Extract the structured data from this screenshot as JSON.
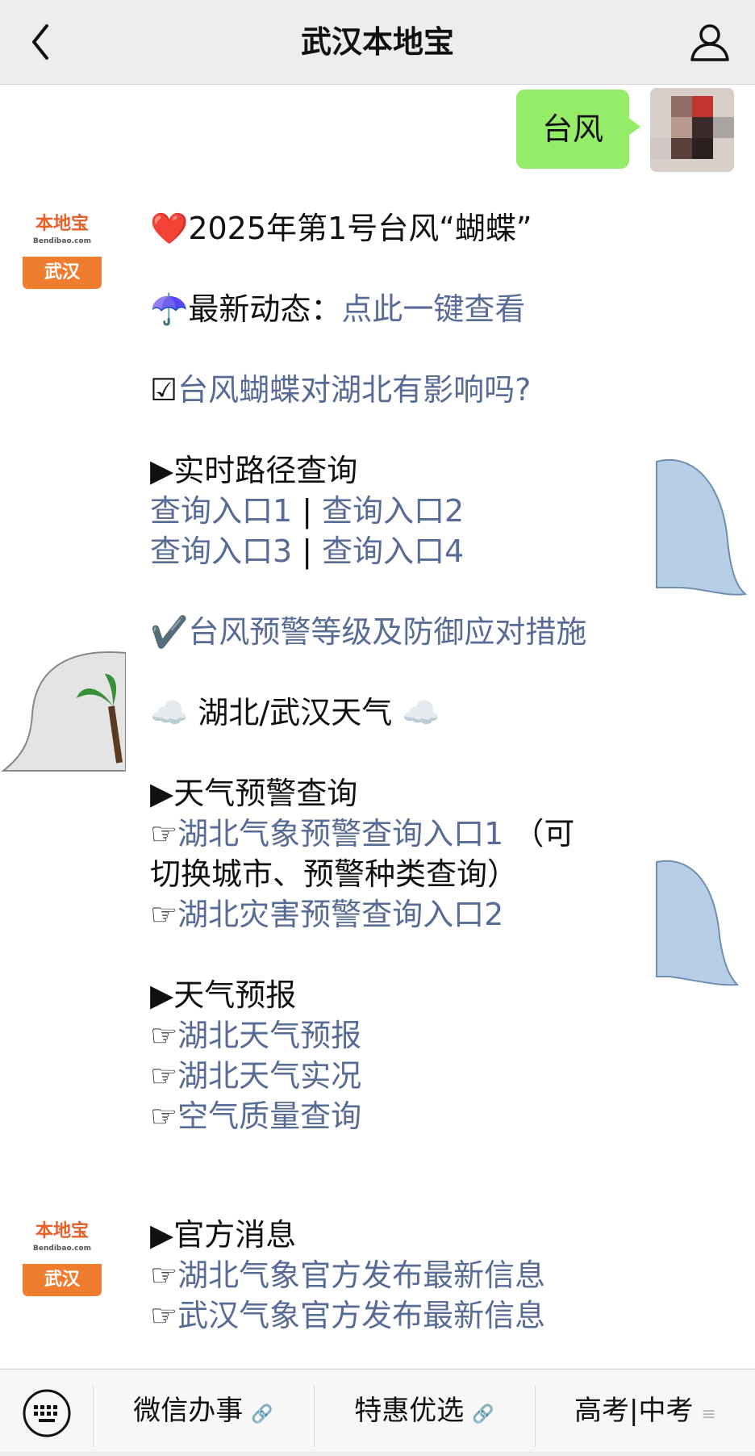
{
  "header": {
    "title": "武汉本地宝"
  },
  "outgoing": {
    "text": "台风"
  },
  "message1": {
    "title": "❤️2025年第1号台风“蝴蝶”",
    "latest_prefix": "☂️最新动态：",
    "latest_link": "点此一键查看",
    "impact_prefix": "☑",
    "impact_link": "台风蝴蝶对湖北有影响吗?",
    "route_heading": "▶实时路径查询",
    "entry1": "查询入口1",
    "entry2": "查询入口2",
    "entry3": "查询入口3",
    "entry4": "查询入口4",
    "separator": "|",
    "warning_prefix": "✔️",
    "warning_link": "台风预警等级及防御应对措施",
    "weather_heading": "☁️ 湖北/武汉天气 ☁️",
    "alert_heading": "▶天气预警查询",
    "hand": "☞",
    "alert_link1": "湖北气象预警查询入口1",
    "alert_note1": "（可",
    "alert_note2": "切换城市、预警种类查询）",
    "alert_link2": "湖北灾害预警查询入口2",
    "forecast_heading": "▶天气预报",
    "forecast_link1": "湖北天气预报",
    "forecast_link2": "湖北天气实况",
    "forecast_link3": "空气质量查询"
  },
  "message2": {
    "heading": "▶官方消息",
    "link1": "湖北气象官方发布最新信息",
    "link2": "武汉气象官方发布最新信息"
  },
  "avatar": {
    "brand": "本地宝",
    "domain": "Bendibao.com",
    "city": "武汉"
  },
  "menu": {
    "item1": "微信办事",
    "item2": "特惠优选",
    "item3": "高考|中考"
  },
  "colors": {
    "link": "#576b95",
    "bubble": "#95ec69",
    "brand": "#ef7d2f"
  }
}
